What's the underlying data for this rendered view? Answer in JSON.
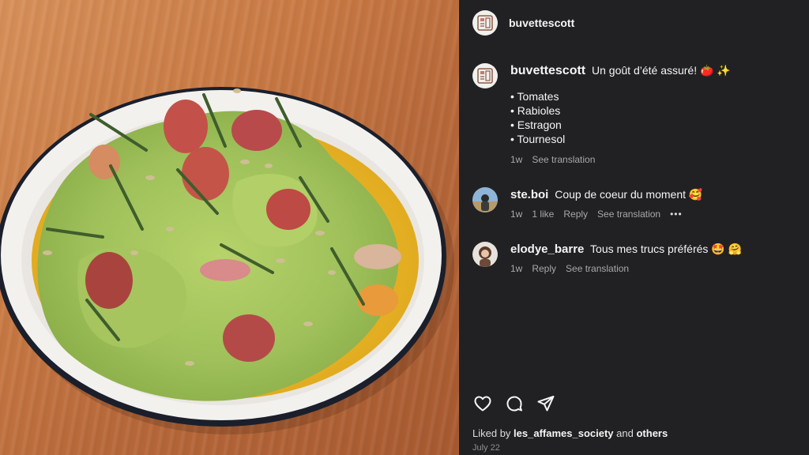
{
  "post": {
    "author": "buvettescott",
    "caption": {
      "username": "buvettescott",
      "text": "Un goût d’été assuré! 🍅 ✨",
      "bullets": [
        "• Tomates",
        "• Rabioles",
        "• Estragon",
        "• Tournesol"
      ],
      "time": "1w",
      "see_translation": "See translation"
    },
    "comments": [
      {
        "username": "ste.boi",
        "text": "Coup de coeur du moment 🥰",
        "time": "1w",
        "likes": "1 like",
        "reply": "Reply",
        "see_translation": "See translation",
        "more": "•••"
      },
      {
        "username": "elodye_barre",
        "text": "Tous mes trucs préférés 🤩 🤗",
        "time": "1w",
        "reply": "Reply",
        "see_translation": "See translation"
      }
    ],
    "liked_by_prefix": "Liked by",
    "liked_by_user": "les_affames_society",
    "liked_by_and": "and",
    "liked_by_others": "others",
    "date": "July 22"
  },
  "icons": {
    "like": "heart-icon",
    "comment": "comment-icon",
    "share": "send-icon"
  }
}
